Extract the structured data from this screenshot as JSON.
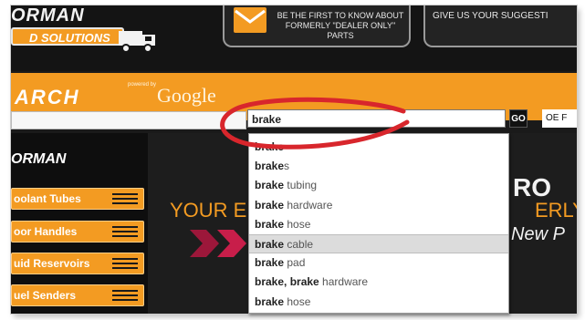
{
  "header": {
    "logo_top": "ORMAN",
    "logo_bar": "D SOLUTIONS",
    "promo_text": "BE THE FIRST TO KNOW ABOUT FORMERLY \"DEALER ONLY\" PARTS",
    "suggest_text": "GIVE US YOUR SUGGESTI"
  },
  "search": {
    "heading": "ARCH",
    "powered_by": "powered by",
    "google": "Google",
    "query": "brake",
    "go_label": "GO",
    "oe_label": "OE F"
  },
  "suggestions": [
    {
      "bold": "brake",
      "rest": ""
    },
    {
      "bold": "brake",
      "rest": "s"
    },
    {
      "bold": "brake",
      "rest": " tubing"
    },
    {
      "bold": "brake",
      "rest": " hardware"
    },
    {
      "bold": "brake",
      "rest": " hose"
    },
    {
      "bold": "brake",
      "rest": " cable"
    },
    {
      "bold": "brake",
      "rest": " pad"
    },
    {
      "bold": "brake, brake",
      "rest": " hardware"
    },
    {
      "bold": "brake",
      "rest": " hose"
    }
  ],
  "selected_index": 5,
  "left_nav": {
    "brand": "ORMAN",
    "items": [
      "oolant Tubes",
      "oor Handles",
      "uid Reservoirs",
      "uel Senders"
    ]
  },
  "banner": {
    "line1": "YOUR E",
    "line2": "RO",
    "line4": "ERLY \"",
    "line3": "New P"
  },
  "colors": {
    "accent": "#f39b22",
    "annotation": "#d8262c",
    "chevron": "#b3163f"
  }
}
